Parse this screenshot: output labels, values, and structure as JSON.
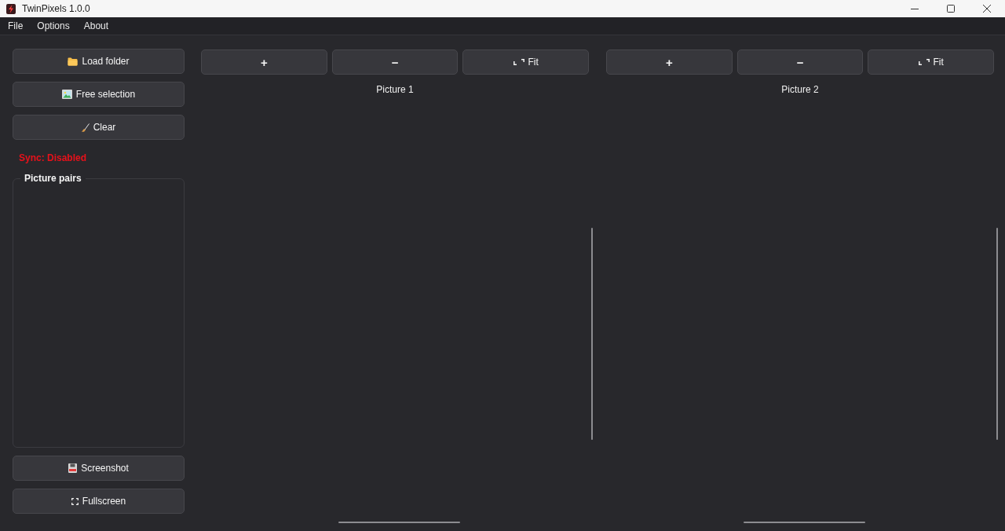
{
  "window": {
    "title": "TwinPixels 1.0.0"
  },
  "menu": [
    "File",
    "Options",
    "About"
  ],
  "sidebar": {
    "top_buttons": [
      {
        "kind": "folder",
        "label": "Load folder"
      },
      {
        "kind": "picture",
        "label": "Free selection"
      },
      {
        "kind": "broom",
        "label": "Clear"
      }
    ],
    "sync": {
      "text": "Sync: Disabled",
      "enabled": false
    },
    "group_title": "Picture pairs",
    "bottom_buttons": [
      {
        "kind": "floppy",
        "label": "Screenshot"
      },
      {
        "kind": "fullscreen",
        "label": "Fullscreen"
      }
    ]
  },
  "viewers": [
    {
      "buttons": [
        {
          "kind": "plus",
          "label": "+"
        },
        {
          "kind": "minus",
          "label": "−"
        },
        {
          "kind": "fit",
          "label": "Fit"
        }
      ],
      "caption": "Picture 1"
    },
    {
      "buttons": [
        {
          "kind": "plus",
          "label": "+"
        },
        {
          "kind": "minus",
          "label": "−"
        },
        {
          "kind": "fit",
          "label": "Fit"
        }
      ],
      "caption": "Picture 2"
    }
  ]
}
